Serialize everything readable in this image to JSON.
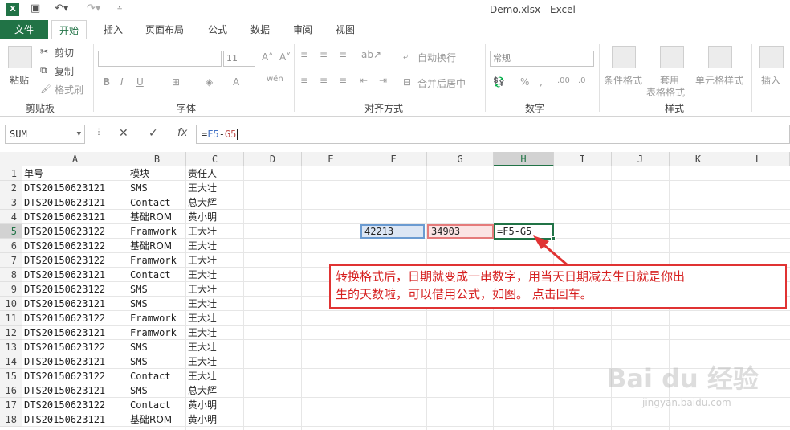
{
  "titlebar": {
    "app_icon": "X",
    "title": "Demo.xlsx - Excel",
    "save_icon": "save-icon",
    "undo_icon": "undo-icon",
    "redo_icon": "redo-icon"
  },
  "tabs": {
    "file": "文件",
    "items": [
      "开始",
      "插入",
      "页面布局",
      "公式",
      "数据",
      "审阅",
      "视图"
    ],
    "active": "开始"
  },
  "ribbon": {
    "clipboard": {
      "label": "剪贴板",
      "paste": "粘贴",
      "cut": "剪切",
      "copy": "复制",
      "format_painter": "格式刷"
    },
    "font": {
      "label": "字体",
      "font_size": "11",
      "bold": "B",
      "italic": "I",
      "underline": "U",
      "font_color": "A",
      "wen": "wén"
    },
    "alignment": {
      "label": "对齐方式",
      "wrap": "自动换行",
      "merge": "合并后居中"
    },
    "number": {
      "label": "数字",
      "format": "常规",
      "percent": "%"
    },
    "styles": {
      "label": "样式",
      "conditional": "条件格式",
      "table_line1": "套用",
      "table_line2": "表格格式",
      "cell_styles": "单元格样式"
    },
    "cells": {
      "insert": "插入"
    }
  },
  "formula_bar": {
    "name_box": "SUM",
    "fx": "fx",
    "formula_eq": "=",
    "formula_ref1": "F5",
    "formula_op": "-",
    "formula_ref2": "G5"
  },
  "sheet": {
    "columns": [
      "A",
      "B",
      "C",
      "D",
      "E",
      "F",
      "G",
      "H",
      "I",
      "J",
      "K",
      "L"
    ],
    "selected_column": "H",
    "selected_row": "5",
    "rows": [
      {
        "n": "1",
        "a": "单号",
        "b": "模块",
        "c": "责任人"
      },
      {
        "n": "2",
        "a": "DTS20150623121",
        "b": "SMS",
        "c": "王大壮"
      },
      {
        "n": "3",
        "a": "DTS20150623121",
        "b": "Contact",
        "c": "总大辉"
      },
      {
        "n": "4",
        "a": "DTS20150623121",
        "b": "基础ROM",
        "c": "黄小明"
      },
      {
        "n": "5",
        "a": "DTS20150623122",
        "b": "Framwork",
        "c": "王大壮"
      },
      {
        "n": "6",
        "a": "DTS20150623122",
        "b": "基础ROM",
        "c": "王大壮"
      },
      {
        "n": "7",
        "a": "DTS20150623122",
        "b": "Framwork",
        "c": "王大壮"
      },
      {
        "n": "8",
        "a": "DTS20150623121",
        "b": "Contact",
        "c": "王大壮"
      },
      {
        "n": "9",
        "a": "DTS20150623122",
        "b": "SMS",
        "c": "王大壮"
      },
      {
        "n": "10",
        "a": "DTS20150623121",
        "b": "SMS",
        "c": "王大壮"
      },
      {
        "n": "11",
        "a": "DTS20150623122",
        "b": "Framwork",
        "c": "王大壮"
      },
      {
        "n": "12",
        "a": "DTS20150623121",
        "b": "Framwork",
        "c": "王大壮"
      },
      {
        "n": "13",
        "a": "DTS20150623122",
        "b": "SMS",
        "c": "王大壮"
      },
      {
        "n": "14",
        "a": "DTS20150623121",
        "b": "SMS",
        "c": "王大壮"
      },
      {
        "n": "15",
        "a": "DTS20150623122",
        "b": "Contact",
        "c": "王大壮"
      },
      {
        "n": "16",
        "a": "DTS20150623121",
        "b": "SMS",
        "c": "总大辉"
      },
      {
        "n": "17",
        "a": "DTS20150623122",
        "b": "Contact",
        "c": "黄小明"
      },
      {
        "n": "18",
        "a": "DTS20150623121",
        "b": "基础ROM",
        "c": "黄小明"
      }
    ],
    "f5": "42213",
    "g5": "34903",
    "h5": "=F5-G5"
  },
  "annotation": {
    "line1": "转换格式后，日期就变成一串数字，用当天日期减去生日就是你出",
    "line2": "生的天数啦，可以借用公式，如图。    点击回车。",
    "color": "#d62020"
  },
  "watermark": {
    "main": "Bai du 经验",
    "sub": "jingyan.baidu.com"
  },
  "colors": {
    "excel_green": "#217346",
    "ref_blue": "#4472c4",
    "ref_red": "#c0504d"
  }
}
